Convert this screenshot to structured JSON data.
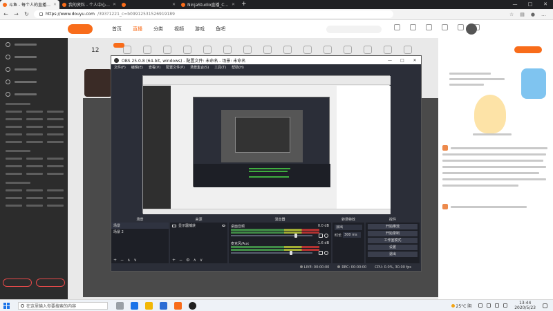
{
  "browser": {
    "tabs": [
      {
        "title": "斗鱼 - 每个人的直播平台",
        "active": true
      },
      {
        "title": "我的资料 - 个人中心 - 斗鱼",
        "active": false
      },
      {
        "title": "",
        "active": false
      },
      {
        "title": "NinjaStudio直播_CSGO直播",
        "active": false
      }
    ],
    "new_tab": "+",
    "url_host": "https://www.douyu.com",
    "url_path": "/393?1221_c=b09912531526919189",
    "window_controls": [
      "—",
      "□",
      "✕"
    ]
  },
  "site": {
    "nav": [
      "首页",
      "直播",
      "分类",
      "视频",
      "游戏",
      "鱼吧"
    ],
    "active_nav": "直播",
    "room_number": "12"
  },
  "obs": {
    "title": "OBS 25.0.8 (64-bit, windows) - 配置文件: 未命名 - 场景: 未命名",
    "menu": [
      "文件(F)",
      "编辑(E)",
      "查看(V)",
      "配置文件(P)",
      "场景集合(S)",
      "工具(T)",
      "帮助(H)"
    ],
    "window_controls": [
      "—",
      "□",
      "✕"
    ],
    "docks": {
      "scenes_title": "场景",
      "sources_title": "来源",
      "mixer_title": "混音器",
      "transitions_title": "转场特效",
      "controls_title": "控件"
    },
    "scenes": [
      "场景",
      "场景 2"
    ],
    "sources": [
      {
        "name": "显示器捕获"
      }
    ],
    "dock_buttons": [
      "+",
      "−",
      "∧",
      "∨"
    ],
    "source_buttons": [
      "+",
      "−",
      "⚙",
      "∧",
      "∨"
    ],
    "mixer": [
      {
        "name": "桌面音频",
        "db": "0.0 dB",
        "level": 0.78
      },
      {
        "name": "麦克风/Aux",
        "db": "-1.6 dB",
        "level": 0.72
      }
    ],
    "transition": {
      "selected": "淡出",
      "duration_label": "时长",
      "duration": "300 ms"
    },
    "controls": [
      "开始推流",
      "开始录制",
      "工作室模式",
      "设置",
      "退出"
    ],
    "status": {
      "live": "LIVE: 00:00:00",
      "rec": "REC: 00:00:00",
      "cpu": "CPU: 0.0%, 30.00 fps"
    }
  },
  "taskbar": {
    "search_placeholder": "在这里输入你要搜索的内容",
    "weather": "25°C 阴",
    "time": "13:44",
    "date": "2020/5/23"
  },
  "colors": {
    "brand": "#f86c1a",
    "obs_bg": "#2b2e38",
    "sidebar_bg": "#2c2c2c"
  }
}
